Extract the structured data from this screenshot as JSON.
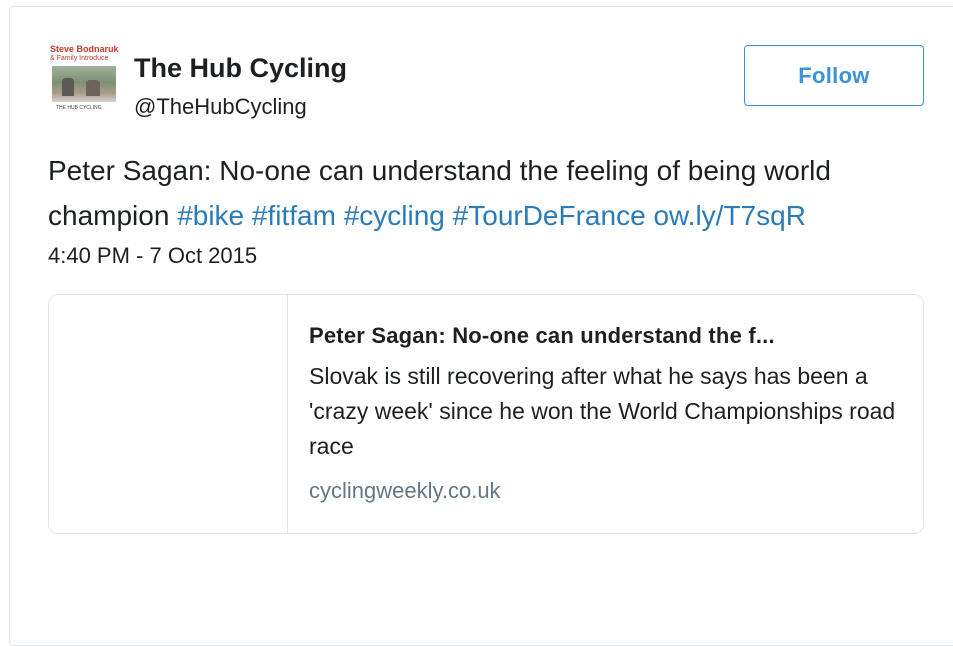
{
  "author": {
    "display_name": "The Hub Cycling",
    "screen_name": "@TheHubCycling",
    "avatar_text_line1": "Steve Bodnaruk",
    "avatar_text_line2": "& Family Introduce",
    "avatar_caption": "THE HUB CYCLING"
  },
  "follow_button": {
    "label": "Follow"
  },
  "tweet": {
    "text_plain": "Peter Sagan: No-one can understand the feeling of being world champion",
    "hashtags": [
      "#bike",
      "#fitfam",
      "#cycling",
      "#TourDeFrance"
    ],
    "link": "ow.ly/T7sqR",
    "timestamp": "4:40 PM - 7 Oct 2015"
  },
  "card": {
    "title": "Peter Sagan: No-one can understand the f...",
    "description": "Slovak is still recovering after what he says has been a 'crazy week' since he won the World Championships road race",
    "domain": "cyclingweekly.co.uk"
  },
  "colors": {
    "link": "#2b7bb9",
    "follow": "#3b94d9",
    "text": "#1c2022",
    "muted": "#657786",
    "border": "#e1e8ed"
  },
  "icons": {
    "avatar": "avatar-image"
  }
}
